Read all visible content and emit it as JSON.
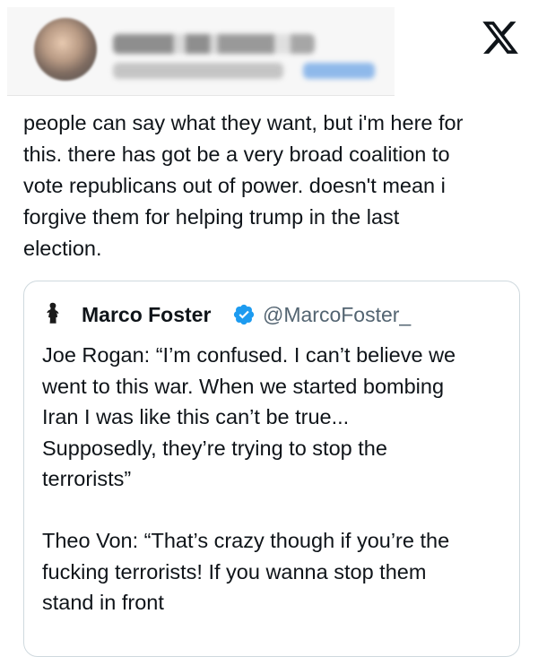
{
  "header": {
    "blurred_author": true
  },
  "tweet": {
    "text": "people can say what they want, but i'm here for\nthis. there has got be a very broad coalition to\nvote republicans out of power. doesn't mean i\nforgive them for helping trump in the last\nelection."
  },
  "quote": {
    "name": "Marco Foster",
    "handle": "@MarcoFoster_",
    "verified": true,
    "text": "Joe Rogan: “I’m confused. I can’t believe we\nwent to this war. When we started bombing\nIran I was like this can’t be true...\nSupposedly, they’re trying to stop the\nterrorists”\n\nTheo Von: “That’s crazy though if you’re the\nfucking terrorists! If you wanna stop them\nstand in front"
  },
  "icons": {
    "brand": "x-logo-icon",
    "verified": "verified-badge-icon",
    "quote_avatar": "statue-avatar-icon"
  },
  "colors": {
    "text": "#0f1419",
    "secondary": "#536471",
    "border": "#cfd9de",
    "verified": "#1d9bf0"
  }
}
